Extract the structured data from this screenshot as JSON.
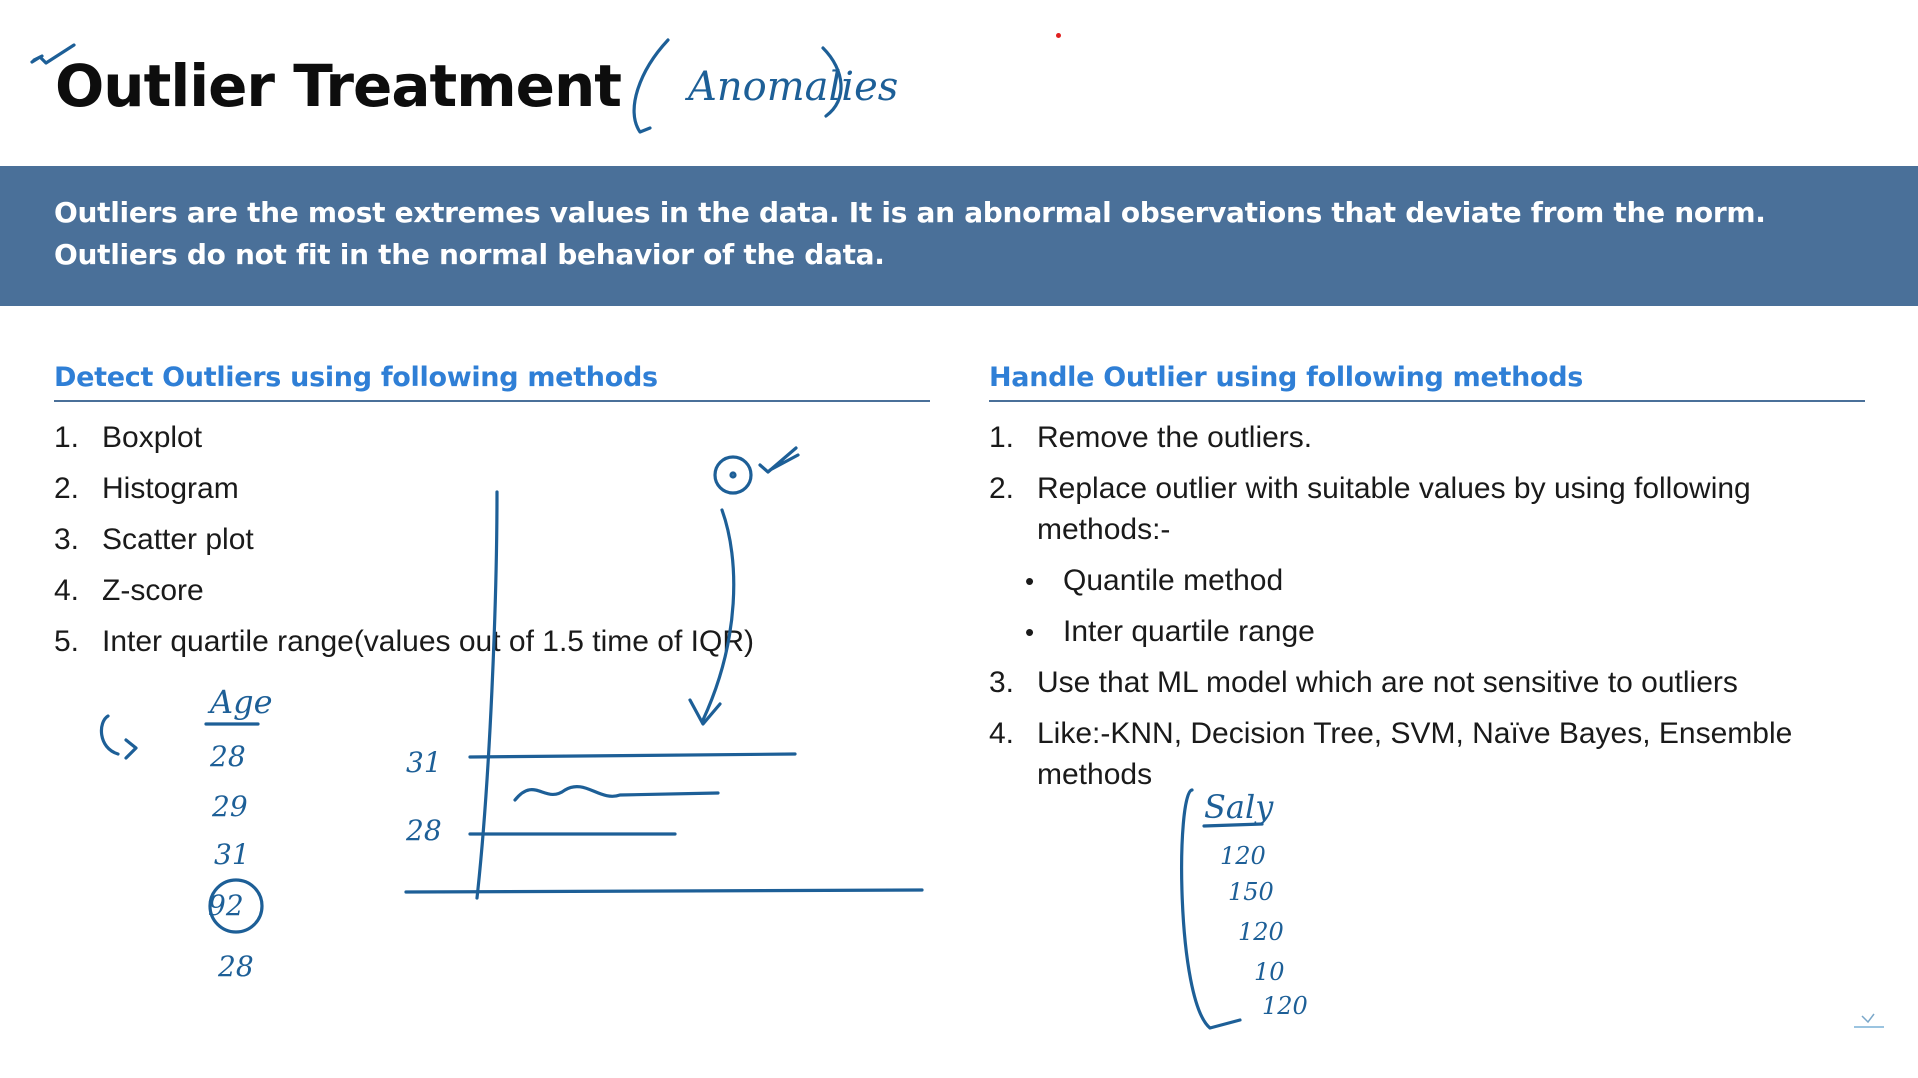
{
  "title": "Outlier Treatment",
  "banner": {
    "line1": "Outliers are the most extremes values in the data. It is an abnormal observations that deviate from the norm.",
    "line2": "Outliers do not fit in the normal behavior of the data."
  },
  "detect": {
    "heading": "Detect Outliers using following methods",
    "items": [
      {
        "num": "1.",
        "text": "Boxplot"
      },
      {
        "num": "2.",
        "text": "Histogram"
      },
      {
        "num": "3.",
        "text": "Scatter plot"
      },
      {
        "num": "4.",
        "text": "Z-score"
      },
      {
        "num": "5.",
        "text": "Inter quartile range(values out of 1.5 time of IQR)"
      }
    ]
  },
  "handle": {
    "heading": "Handle Outlier using following methods",
    "items": [
      {
        "num": "1.",
        "text": "Remove the outliers."
      },
      {
        "num": "2.",
        "text": "Replace outlier with suitable values by using following",
        "cont": "methods:-"
      },
      {
        "num": "3.",
        "text": "Use that ML model which are not sensitive to outliers"
      },
      {
        "num": "4.",
        "text": "Like:-KNN, Decision Tree, SVM, Naïve Bayes, Ensemble",
        "cont": "methods"
      }
    ],
    "subitems": [
      {
        "bullet": "•",
        "text": "Quantile method"
      },
      {
        "bullet": "•",
        "text": "Inter quartile range"
      }
    ]
  },
  "annotations": {
    "anomalies": "Anomalies",
    "age_header": "Age",
    "age_values": [
      "28",
      "29",
      "31",
      "92",
      "28"
    ],
    "axis_labels": [
      "31",
      "28"
    ],
    "salary_header": "Saly",
    "salary_values": [
      "120",
      "150",
      "120",
      "10",
      "120"
    ]
  }
}
